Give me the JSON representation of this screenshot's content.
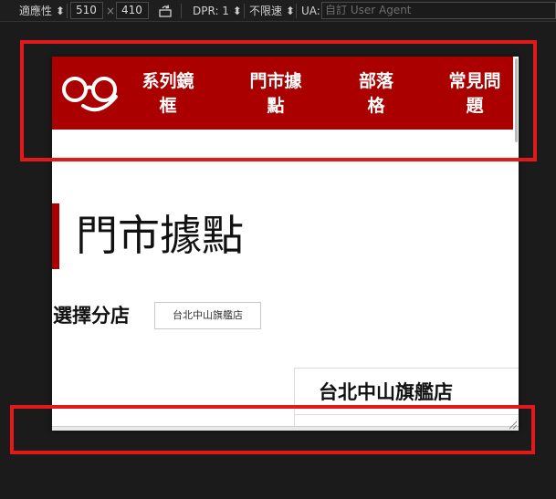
{
  "toolbar": {
    "mode": "適應性",
    "width": "510",
    "times": "×",
    "height": "410",
    "dpr": "DPR: 1",
    "throttle": "不限速",
    "ua_label": "UA:",
    "ua_placeholder": "自訂 User Agent"
  },
  "site": {
    "nav": [
      {
        "line1": "系列鏡",
        "line2": "框"
      },
      {
        "line1": "門市據",
        "line2": "點"
      },
      {
        "line1": "部落",
        "line2": "格"
      },
      {
        "line1": "常見問",
        "line2": "題"
      }
    ],
    "page_title": "門市據點",
    "branch_label": "選擇分店",
    "branch_selected": "台北中山旗艦店",
    "card_title": "台北中山旗艦店"
  },
  "colors": {
    "brand_red": "#ab0000",
    "annotation_red": "#e31818"
  },
  "icons": {
    "logo": "glasses-smile-logo",
    "rotate": "rotate-icon",
    "resize": "resize-grip-icon"
  }
}
